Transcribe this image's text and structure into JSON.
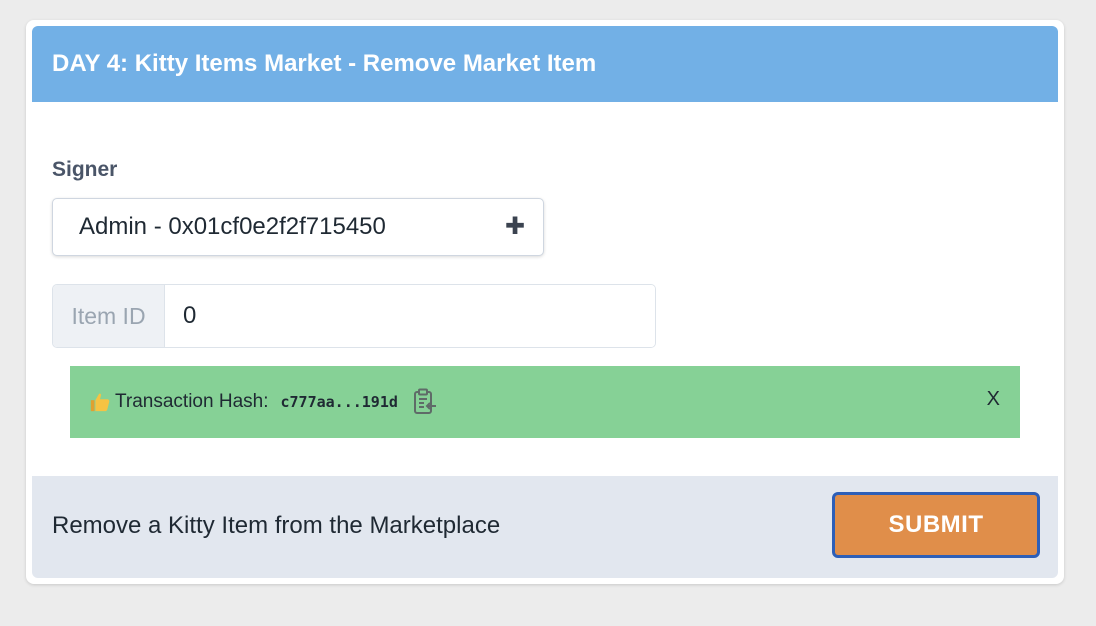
{
  "header": {
    "title": "DAY 4: Kitty Items Market - Remove Market Item"
  },
  "signer": {
    "label": "Signer",
    "value": "Admin - 0x01cf0e2f2f715450",
    "icon": "plus-icon"
  },
  "item_field": {
    "addon_label": "Item ID",
    "value": "0"
  },
  "alert": {
    "icon": "thumbs-up-icon",
    "label": "Transaction Hash:",
    "hash": "c777aa...191d",
    "copy_icon": "clipboard-icon",
    "close_label": "X",
    "color": "#86d196"
  },
  "footer": {
    "description": "Remove a Kitty Item from the Marketplace",
    "submit_label": "SUBMIT"
  },
  "colors": {
    "header": "#72b0e6",
    "submit": "#e08e4a",
    "submit_border": "#2d5fb8",
    "footer": "#e2e7ef"
  }
}
